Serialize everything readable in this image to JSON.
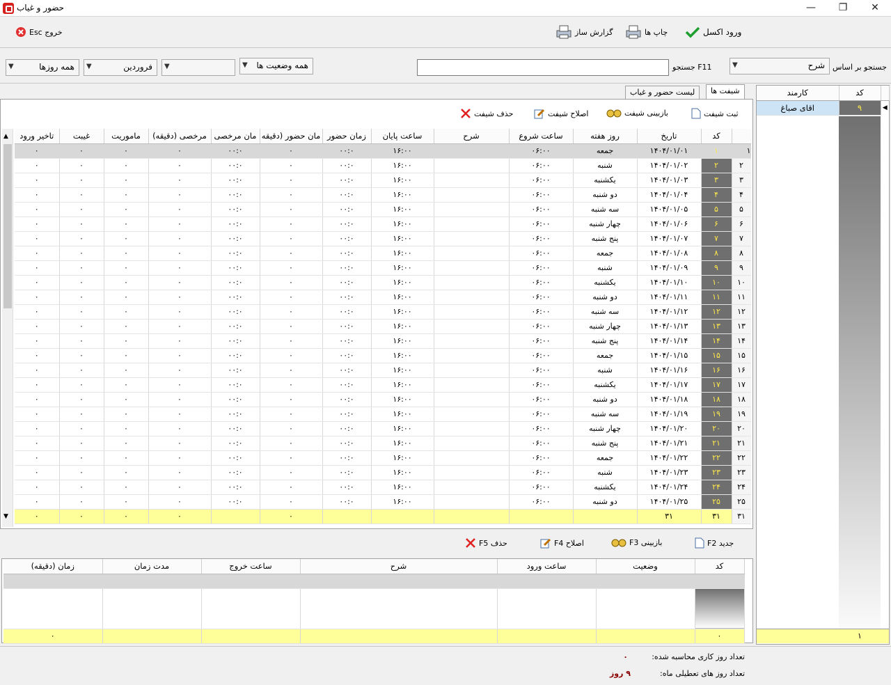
{
  "window": {
    "title": "حضور و غیاب"
  },
  "toolbar": {
    "excel": "ورود اکسل",
    "prints": "چاپ ها",
    "report_builder": "گزارش ساز",
    "exit": "خروج Esc"
  },
  "filters": {
    "search_by_label": "جستجو بر اساس",
    "search_by_value": "شرح",
    "search_label": "F11 جستجو",
    "search_value": "",
    "status_value": "همه وضعیت ها",
    "blank_combo": "",
    "month_value": "فروردین",
    "days_value": "همه روزها"
  },
  "tabs": {
    "shifts": "شیفت ها",
    "attendance_list": "لیست حضور و غیاب"
  },
  "shift_actions": {
    "register": "ثبت شیفت",
    "view": "بازبینی شیفت",
    "edit": "اصلاح شیفت",
    "delete": "حذف شیفت"
  },
  "shift_table": {
    "columns": [
      "کد",
      "تاریخ",
      "روز هفته",
      "ساعت شروع",
      "شرح",
      "ساعت پایان",
      "زمان حضور",
      "زمان حضور (دقیقه)",
      "زمان مرخصی",
      "مرخصی (دقیقه)",
      "ماموریت",
      "غیبت",
      "تاخیر ورود"
    ],
    "col_labels": {
      "kod": "کد",
      "date": "تاریخ",
      "weekday": "روز هفته",
      "start": "ساعت شروع",
      "desc": "شرح",
      "end": "ساعت پایان",
      "presence": "زمان حضور",
      "presence_min": "مان حضور (دقیقه",
      "leave": "مان مرخصی",
      "leave_min": "مرخصی (دقیقه)",
      "mission": "ماموریت",
      "absence": "غیبت",
      "late": "تاخیر ورود"
    },
    "rows": [
      {
        "rn": "۱",
        "kod": "۱",
        "date": "۱۴۰۴/۰۱/۰۱",
        "day": "جمعه"
      },
      {
        "rn": "۲",
        "kod": "۲",
        "date": "۱۴۰۴/۰۱/۰۲",
        "day": "شنبه"
      },
      {
        "rn": "۳",
        "kod": "۳",
        "date": "۱۴۰۴/۰۱/۰۳",
        "day": "یکشنبه"
      },
      {
        "rn": "۴",
        "kod": "۴",
        "date": "۱۴۰۴/۰۱/۰۴",
        "day": "دو شنبه"
      },
      {
        "rn": "۵",
        "kod": "۵",
        "date": "۱۴۰۴/۰۱/۰۵",
        "day": "سه شنبه"
      },
      {
        "rn": "۶",
        "kod": "۶",
        "date": "۱۴۰۴/۰۱/۰۶",
        "day": "چهار شنبه"
      },
      {
        "rn": "۷",
        "kod": "۷",
        "date": "۱۴۰۴/۰۱/۰۷",
        "day": "پنج شنبه"
      },
      {
        "rn": "۸",
        "kod": "۸",
        "date": "۱۴۰۴/۰۱/۰۸",
        "day": "جمعه"
      },
      {
        "rn": "۹",
        "kod": "۹",
        "date": "۱۴۰۴/۰۱/۰۹",
        "day": "شنبه"
      },
      {
        "rn": "۱۰",
        "kod": "۱۰",
        "date": "۱۴۰۴/۰۱/۱۰",
        "day": "یکشنبه"
      },
      {
        "rn": "۱۱",
        "kod": "۱۱",
        "date": "۱۴۰۴/۰۱/۱۱",
        "day": "دو شنبه"
      },
      {
        "rn": "۱۲",
        "kod": "۱۲",
        "date": "۱۴۰۴/۰۱/۱۲",
        "day": "سه شنبه"
      },
      {
        "rn": "۱۳",
        "kod": "۱۳",
        "date": "۱۴۰۴/۰۱/۱۳",
        "day": "چهار شنبه"
      },
      {
        "rn": "۱۴",
        "kod": "۱۴",
        "date": "۱۴۰۴/۰۱/۱۴",
        "day": "پنج شنبه"
      },
      {
        "rn": "۱۵",
        "kod": "۱۵",
        "date": "۱۴۰۴/۰۱/۱۵",
        "day": "جمعه"
      },
      {
        "rn": "۱۶",
        "kod": "۱۶",
        "date": "۱۴۰۴/۰۱/۱۶",
        "day": "شنبه"
      },
      {
        "rn": "۱۷",
        "kod": "۱۷",
        "date": "۱۴۰۴/۰۱/۱۷",
        "day": "یکشنبه"
      },
      {
        "rn": "۱۸",
        "kod": "۱۸",
        "date": "۱۴۰۴/۰۱/۱۸",
        "day": "دو شنبه"
      },
      {
        "rn": "۱۹",
        "kod": "۱۹",
        "date": "۱۴۰۴/۰۱/۱۹",
        "day": "سه شنبه"
      },
      {
        "rn": "۲۰",
        "kod": "۲۰",
        "date": "۱۴۰۴/۰۱/۲۰",
        "day": "چهار شنبه"
      },
      {
        "rn": "۲۱",
        "kod": "۲۱",
        "date": "۱۴۰۴/۰۱/۲۱",
        "day": "پنج شنبه"
      },
      {
        "rn": "۲۲",
        "kod": "۲۲",
        "date": "۱۴۰۴/۰۱/۲۲",
        "day": "جمعه"
      },
      {
        "rn": "۲۳",
        "kod": "۲۳",
        "date": "۱۴۰۴/۰۱/۲۳",
        "day": "شنبه"
      },
      {
        "rn": "۲۴",
        "kod": "۲۴",
        "date": "۱۴۰۴/۰۱/۲۴",
        "day": "یکشنبه"
      },
      {
        "rn": "۲۵",
        "kod": "۲۵",
        "date": "۱۴۰۴/۰۱/۲۵",
        "day": "دو شنبه"
      }
    ],
    "defaults": {
      "start": "۰۶:۰۰",
      "end": "۱۶:۰۰",
      "presence": "۰۰:۰",
      "presence_min": "۰",
      "leave": "۰۰:۰",
      "leave_min": "۰",
      "mission": "۰",
      "absence": "۰",
      "late": "۰"
    },
    "footer": {
      "rn": "۳۱",
      "kod": "۳۱",
      "date": "۳۱",
      "presence_min": "۰",
      "leave_min": "۰",
      "mission": "۰",
      "absence": "۰",
      "late": "۰"
    }
  },
  "entry_actions": {
    "new": "جدید F2",
    "view": "بازبینی F3",
    "edit": "اصلاح F4",
    "delete": "حذف F5"
  },
  "entry_table": {
    "col_labels": {
      "kod": "کد",
      "status": "وضعیت",
      "in": "ساعت ورود",
      "desc": "شرح",
      "out": "ساعت خروج",
      "duration": "مدت زمان",
      "minutes": "زمان (دقیقه)"
    },
    "footer": {
      "kod": "۰",
      "minutes": "۰"
    }
  },
  "employee_table": {
    "col_labels": {
      "kod": "کد",
      "name": "کارمند"
    },
    "rows": [
      {
        "kod": "۹",
        "name": "اقای صباغ"
      }
    ],
    "footer": {
      "kod": "۱"
    }
  },
  "summary": {
    "work_days_label": "تعداد روز کاری محاسبه شده:",
    "work_days_value": "۰",
    "holidays_label": "تعداد روز های تعطیلی ماه:",
    "holidays_value": "۹ روز"
  }
}
